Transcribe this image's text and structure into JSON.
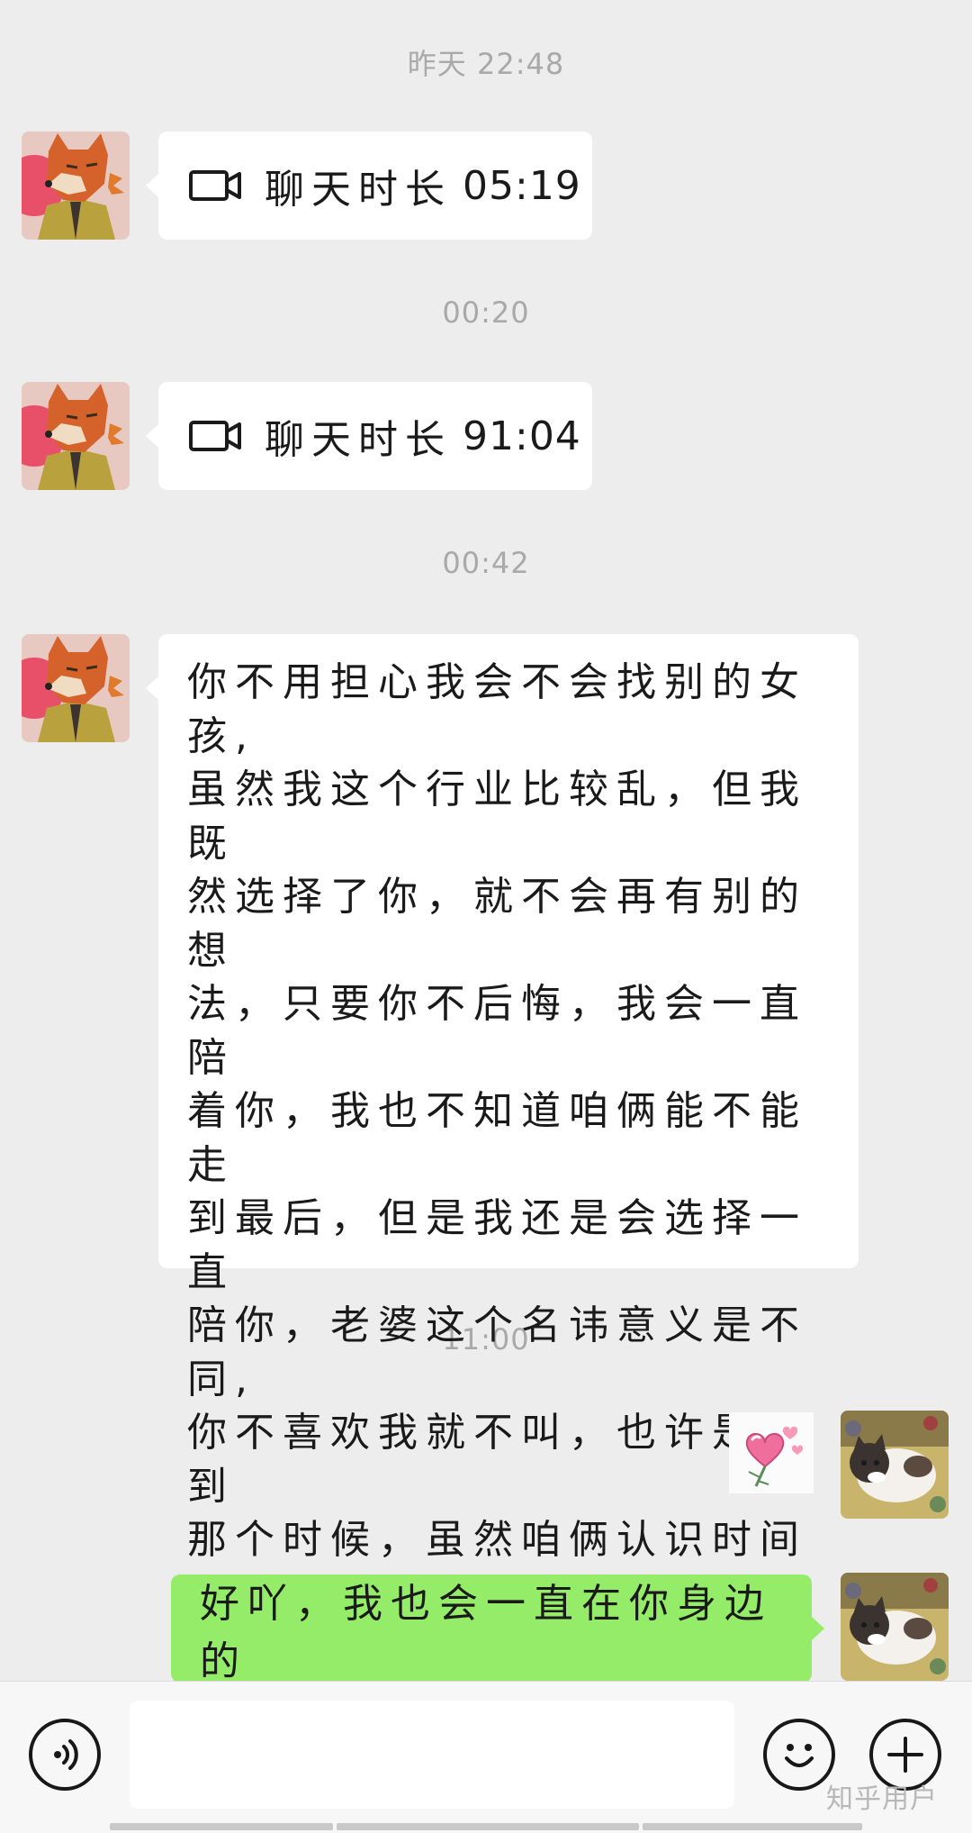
{
  "timestamps": [
    "昨天 22:48",
    "00:20",
    "00:42",
    "11:00"
  ],
  "call_1": {
    "icon": "video-call-icon",
    "label": "聊天时长",
    "duration": "05:19"
  },
  "call_2": {
    "icon": "video-call-icon",
    "label": "聊天时长",
    "duration": "91:04"
  },
  "message_long": "你不用担心我会不会找别的女孩,\n虽然我这个行业比较乱，但我既\n然选择了你，就不会再有别的想\n法，只要你不后悔，我会一直陪\n着你，我也不知道咱俩能不能走\n到最后，但是我还是会选择一直\n陪你，老婆这个名讳意义是不同,\n你不喜欢我就不叫，也许是没到\n那个时候，虽然咱俩认识时间不\n长，但是每一天我都挺开心的，\n谢谢有你，",
  "sticker": {
    "icon": "heart-sticker-icon"
  },
  "message_green": "好吖，我也会一直在你身边的",
  "input_bar": {
    "voice_icon": "voice-icon",
    "input_value": "",
    "emoji_icon": "emoji-icon",
    "plus_icon": "plus-icon"
  },
  "watermark": "知乎用户",
  "colors": {
    "background": "#ededed",
    "bubble_left": "#ffffff",
    "bubble_right": "#95ec69",
    "timestamp": "#a9a9a9"
  }
}
